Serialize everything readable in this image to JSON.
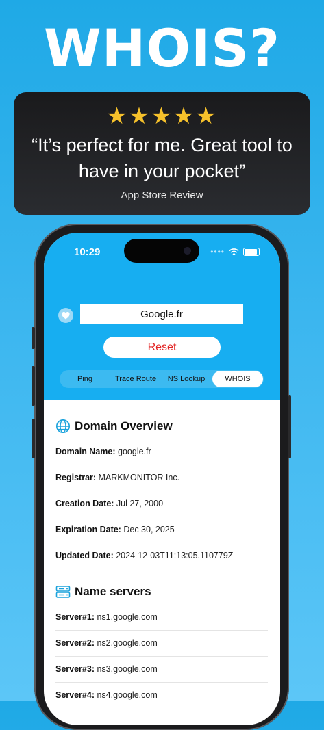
{
  "headline": "WHOIS?",
  "review": {
    "stars": "★★★★★",
    "quote": "“It’s perfect for me. Great tool to have in your pocket”",
    "source": "App Store Review"
  },
  "status": {
    "time": "10:29"
  },
  "query": {
    "value": "Google.fr"
  },
  "reset_label": "Reset",
  "tabs": [
    {
      "label": "Ping",
      "active": false
    },
    {
      "label": "Trace Route",
      "active": false
    },
    {
      "label": "NS Lookup",
      "active": false
    },
    {
      "label": "WHOIS",
      "active": true
    }
  ],
  "overview": {
    "title": "Domain Overview",
    "rows": [
      {
        "label": "Domain Name:",
        "value": "google.fr"
      },
      {
        "label": "Registrar:",
        "value": "MARKMONITOR Inc."
      },
      {
        "label": "Creation Date:",
        "value": "Jul 27, 2000"
      },
      {
        "label": "Expiration Date:",
        "value": "Dec 30, 2025"
      },
      {
        "label": "Updated Date:",
        "value": "2024-12-03T11:13:05.110779Z"
      }
    ]
  },
  "nameservers": {
    "title": "Name servers",
    "rows": [
      {
        "label": "Server#1:",
        "value": "ns1.google.com"
      },
      {
        "label": "Server#2:",
        "value": "ns2.google.com"
      },
      {
        "label": "Server#3:",
        "value": "ns3.google.com"
      },
      {
        "label": "Server#4:",
        "value": "ns4.google.com"
      }
    ]
  },
  "colors": {
    "accent": "#17aef1",
    "reset": "#e22222",
    "stars": "#f6c12b"
  },
  "icons": [
    "heart-icon",
    "globe-icon",
    "server-icon",
    "wifi-icon",
    "battery-icon"
  ]
}
